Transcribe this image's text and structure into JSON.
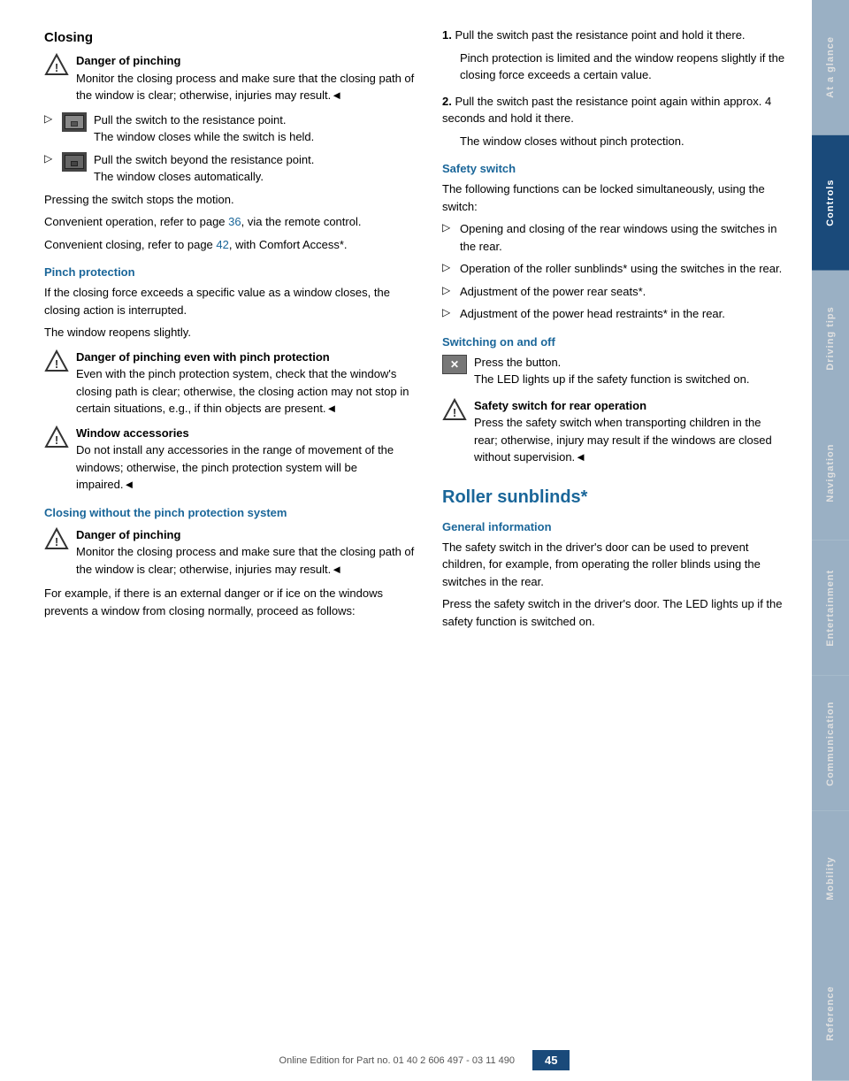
{
  "page": {
    "number": "45",
    "footer_text": "Online Edition for Part no. 01 40 2 606 497 - 03 11 490"
  },
  "sidebar": {
    "tabs": [
      {
        "label": "At a glance",
        "active": false
      },
      {
        "label": "Controls",
        "active": true
      },
      {
        "label": "Driving tips",
        "active": false
      },
      {
        "label": "Navigation",
        "active": false
      },
      {
        "label": "Entertainment",
        "active": false
      },
      {
        "label": "Communication",
        "active": false
      },
      {
        "label": "Mobility",
        "active": false
      },
      {
        "label": "Reference",
        "active": false
      }
    ]
  },
  "left_col": {
    "main_title": "Closing",
    "warning1_title": "Danger of pinching",
    "warning1_text": "Monitor the closing process and make sure that the closing path of the window is clear; otherwise, injuries may result.◄",
    "bullet1_text": "Pull the switch to the resistance point.",
    "bullet1_sub": "The window closes while the switch is held.",
    "bullet2_text": "Pull the switch beyond the resistance point.",
    "bullet2_sub": "The window closes automatically.",
    "press_text": "Pressing the switch stops the motion.",
    "convenient1": "Convenient operation, refer to page ",
    "convenient1_page": "36",
    "convenient1_suffix": ", via the remote control.",
    "convenient2": "Convenient closing, refer to page ",
    "convenient2_page": "42",
    "convenient2_suffix": ", with Comfort Access*.",
    "pinch_title": "Pinch protection",
    "pinch_text1": "If the closing force exceeds a specific value as a window closes, the closing action is interrupted.",
    "pinch_text2": "The window reopens slightly.",
    "warning2_title": "Danger of pinching even with pinch protection",
    "warning2_text": "Even with the pinch protection system, check that the window's closing path is clear; otherwise, the closing action may not stop in certain situations, e.g., if thin objects are present.◄",
    "warning3_title": "Window accessories",
    "warning3_text": "Do not install any accessories in the range of movement of the windows; otherwise, the pinch protection system will be impaired.◄",
    "closing_nopinch_title": "Closing without the pinch protection system",
    "warning4_title": "Danger of pinching",
    "warning4_text": "Monitor the closing process and make sure that the closing path of the window is clear; otherwise, injuries may result.◄",
    "external_danger_text": "For example, if there is an external danger or if ice on the windows prevents a window from closing normally, proceed as follows:"
  },
  "right_col": {
    "step1_num": "1.",
    "step1_text": "Pull the switch past the resistance point and hold it there.",
    "step1_sub": "Pinch protection is limited and the window reopens slightly if the closing force exceeds a certain value.",
    "step2_num": "2.",
    "step2_text": "Pull the switch past the resistance point again within approx. 4 seconds and hold it there.",
    "step2_sub": "The window closes without pinch protection.",
    "safety_title": "Safety switch",
    "safety_text": "The following functions can be locked simultaneously, using the switch:",
    "safety_bullet1": "Opening and closing of the rear windows using the switches in the rear.",
    "safety_bullet2": "Operation of the roller sunblinds* using the switches in the rear.",
    "safety_bullet3": "Adjustment of the power rear seats*.",
    "safety_bullet4": "Adjustment of the power head restraints* in the rear.",
    "switching_title": "Switching on and off",
    "switching_step1": "Press the button.",
    "switching_step1_sub": "The LED lights up if the safety function is switched on.",
    "warning5_title": "Safety switch for rear operation",
    "warning5_text": "Press the safety switch when transporting children in the rear; otherwise, injury may result if the windows are closed without supervision.◄",
    "roller_title": "Roller sunblinds*",
    "general_info_title": "General information",
    "general_text1": "The safety switch in the driver's door can be used to prevent children, for example, from operating the roller blinds using the switches in the rear.",
    "general_text2": "Press the safety switch in the driver's door. The LED lights up if the safety function is switched on."
  }
}
